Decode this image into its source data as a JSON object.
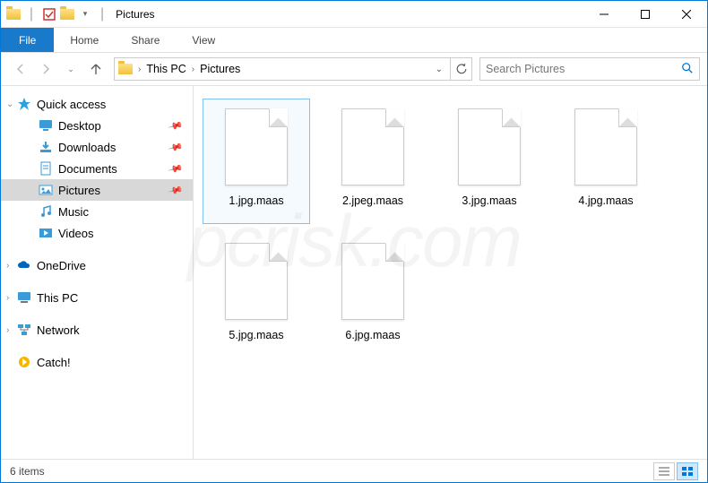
{
  "titlebar": {
    "title": "Pictures"
  },
  "ribbon": {
    "file": "File",
    "tabs": [
      "Home",
      "Share",
      "View"
    ]
  },
  "address": {
    "root": "This PC",
    "current": "Pictures"
  },
  "search": {
    "placeholder": "Search Pictures"
  },
  "sidebar": {
    "quick_access": "Quick access",
    "items": [
      {
        "label": "Desktop",
        "pinned": true
      },
      {
        "label": "Downloads",
        "pinned": true
      },
      {
        "label": "Documents",
        "pinned": true
      },
      {
        "label": "Pictures",
        "pinned": true,
        "selected": true
      },
      {
        "label": "Music",
        "pinned": false
      },
      {
        "label": "Videos",
        "pinned": false
      }
    ],
    "onedrive": "OneDrive",
    "thispc": "This PC",
    "network": "Network",
    "catch": "Catch!"
  },
  "files": [
    {
      "name": "1.jpg.maas",
      "selected": true
    },
    {
      "name": "2.jpeg.maas",
      "selected": false
    },
    {
      "name": "3.jpg.maas",
      "selected": false
    },
    {
      "name": "4.jpg.maas",
      "selected": false
    },
    {
      "name": "5.jpg.maas",
      "selected": false
    },
    {
      "name": "6.jpg.maas",
      "selected": false
    }
  ],
  "status": {
    "count": "6 items"
  },
  "watermark": "pcrisk.com"
}
